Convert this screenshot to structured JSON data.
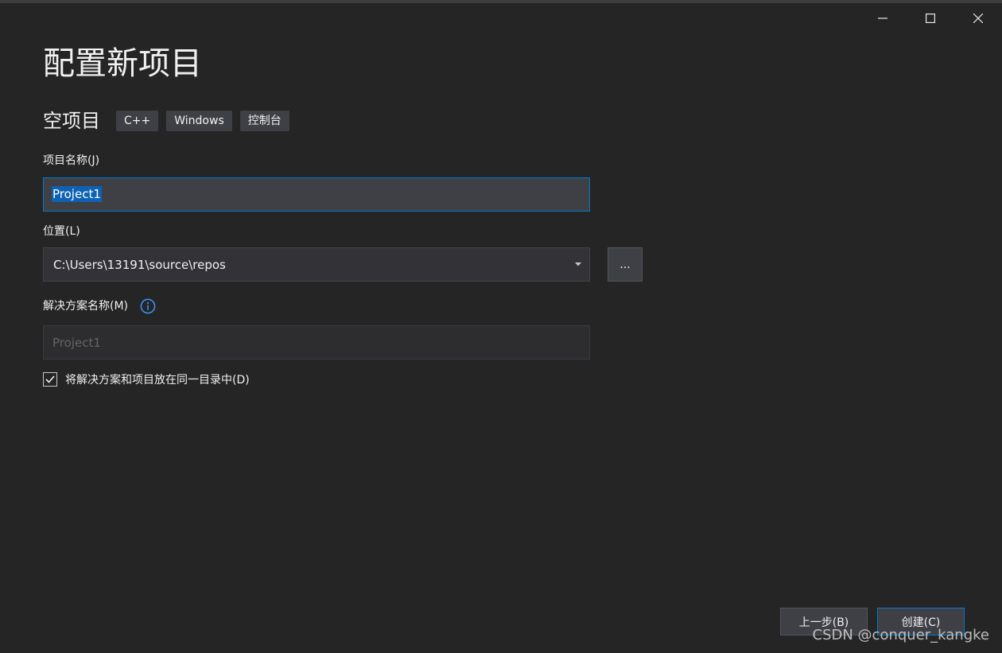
{
  "window": {
    "controls": [
      "minimize",
      "maximize",
      "close"
    ]
  },
  "dialog": {
    "title": "配置新项目",
    "template": {
      "name": "空项目",
      "tags": [
        "C++",
        "Windows",
        "控制台"
      ]
    },
    "project_name": {
      "label": "项目名称(J)",
      "value": "Project1",
      "selected": true
    },
    "location": {
      "label": "位置(L)",
      "value": "C:\\Users\\13191\\source\\repos",
      "browse_label": "..."
    },
    "solution_name": {
      "label": "解决方案名称(M)",
      "placeholder": "Project1",
      "disabled": true
    },
    "same_directory": {
      "label": "将解决方案和项目放在同一目录中(D)",
      "checked": true
    },
    "buttons": {
      "back": "上一步(B)",
      "create": "创建(C)"
    }
  },
  "watermark": "CSDN @conquer_kangke",
  "colors": {
    "background": "#252526",
    "field": "#3f3f46",
    "accent": "#007acc",
    "selection": "#0e62b4"
  },
  "icons": {
    "minimize": "minimize-icon",
    "maximize": "maximize-icon",
    "close": "close-icon",
    "dropdown": "chevron-down-icon",
    "info": "info-icon",
    "checkbox": "checkmark-icon"
  }
}
